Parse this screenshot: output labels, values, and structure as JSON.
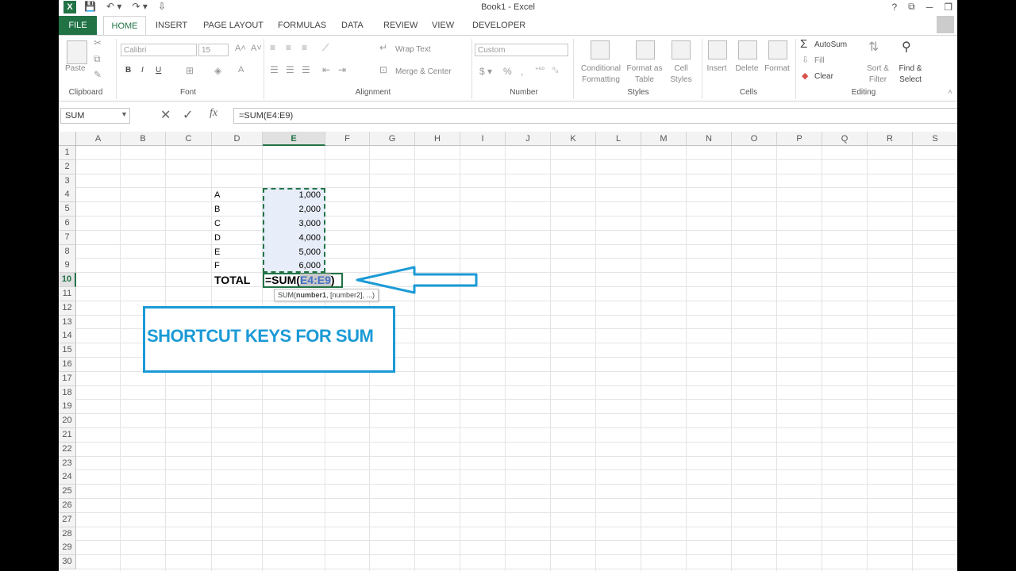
{
  "window": {
    "title": "Book1 - Excel",
    "controls": [
      "?",
      "⧉",
      "─",
      "❐"
    ]
  },
  "tabs": [
    "FILE",
    "HOME",
    "INSERT",
    "PAGE LAYOUT",
    "FORMULAS",
    "DATA",
    "REVIEW",
    "VIEW",
    "DEVELOPER"
  ],
  "ribbon": {
    "clipboard": {
      "paste": "Paste",
      "label": "Clipboard"
    },
    "font": {
      "name": "Calibri",
      "size": "15",
      "bold": "B",
      "italic": "I",
      "underline": "U",
      "label": "Font"
    },
    "alignment": {
      "wrap": "Wrap Text",
      "merge": "Merge & Center",
      "label": "Alignment"
    },
    "number": {
      "format": "Custom",
      "label": "Number"
    },
    "styles": {
      "cond1": "Conditional",
      "cond2": "Formatting",
      "fmt1": "Format as",
      "fmt2": "Table",
      "cell1": "Cell",
      "cell2": "Styles",
      "label": "Styles"
    },
    "cells": {
      "insert": "Insert",
      "delete": "Delete",
      "format": "Format",
      "label": "Cells"
    },
    "editing": {
      "autosum": "AutoSum",
      "fill": "Fill",
      "clear": "Clear",
      "sort1": "Sort &",
      "sort2": "Filter",
      "find1": "Find &",
      "find2": "Select",
      "label": "Editing"
    }
  },
  "formula_bar": {
    "name_box": "SUM",
    "formula": "=SUM(E4:E9)"
  },
  "grid": {
    "columns": [
      "A",
      "B",
      "C",
      "D",
      "E",
      "F",
      "G",
      "H",
      "I",
      "J",
      "K",
      "L",
      "M",
      "N",
      "O",
      "P",
      "Q",
      "R",
      "S"
    ],
    "rows": [
      "1",
      "2",
      "3",
      "4",
      "5",
      "6",
      "7",
      "8",
      "9",
      "10",
      "11",
      "12",
      "13",
      "14",
      "15",
      "16",
      "17",
      "18",
      "19",
      "20",
      "21",
      "22",
      "23",
      "24",
      "25",
      "26",
      "27",
      "28",
      "29",
      "30"
    ],
    "labels": [
      "A",
      "B",
      "C",
      "D",
      "E",
      "F"
    ],
    "values": [
      "1,000",
      "2,000",
      "3,000",
      "4,000",
      "5,000",
      "6,000"
    ],
    "total_label": "TOTAL",
    "edit_prefix": "=SUM(",
    "edit_ref": "E4:E9",
    "edit_suffix": ")",
    "tooltip_pre": "SUM(",
    "tooltip_bold": "number1",
    "tooltip_post": ", [number2], ...)"
  },
  "annotation": {
    "text": "SHORTCUT KEYS FOR SUM",
    "color": "#1b9ad6"
  }
}
